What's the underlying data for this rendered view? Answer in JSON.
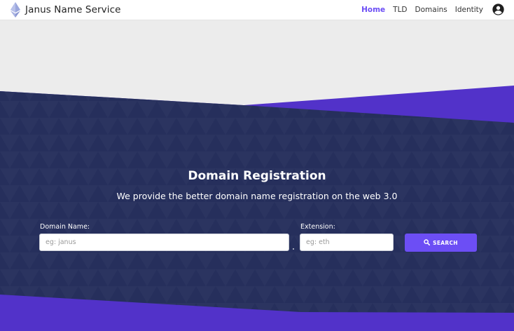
{
  "brand": {
    "name": "Janus Name Service",
    "logo_icon": "ethereum-diamond-icon"
  },
  "nav": {
    "links": [
      {
        "label": "Home",
        "active": true
      },
      {
        "label": "TLD",
        "active": false
      },
      {
        "label": "Domains",
        "active": false
      },
      {
        "label": "Identity",
        "active": false
      }
    ],
    "account_icon": "account-circle-icon"
  },
  "hero": {
    "title": "Domain Registration",
    "subtitle": "We provide the better domain name registration on the web 3.0"
  },
  "form": {
    "domain_label": "Domain Name:",
    "domain_placeholder": "eg: janus",
    "domain_value": "",
    "extension_label": "Extension:",
    "extension_placeholder": "eg: eth",
    "extension_value": "",
    "search_label": "SEARCH",
    "search_icon": "search-icon"
  },
  "colors": {
    "accent": "#6c4ef5",
    "hero_navy": "#262f5c",
    "hero_purple": "#5232c9",
    "page_bg": "#ececec"
  }
}
